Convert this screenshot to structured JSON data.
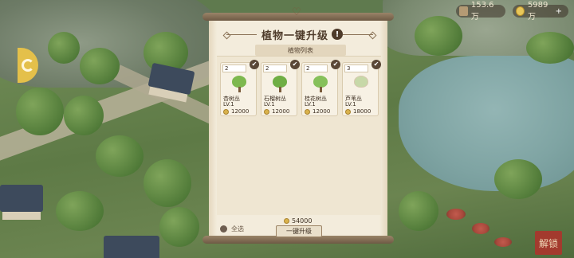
{
  "resources": {
    "gem_amount": "153.6万",
    "coin_amount": "5989万",
    "coin_plus": "+"
  },
  "dialog": {
    "title": "植物一键升级",
    "info_glyph": "!",
    "list_tab": "植物列表",
    "plants": [
      {
        "qty": "2",
        "name": "杏树丛",
        "level": "LV.1",
        "cost": "12000",
        "color": "#7db84e"
      },
      {
        "qty": "2",
        "name": "石榴树丛",
        "level": "LV.1",
        "cost": "12000",
        "color": "#6fae44"
      },
      {
        "qty": "2",
        "name": "桂花树丛",
        "level": "LV.1",
        "cost": "12000",
        "color": "#86c05a"
      },
      {
        "qty": "3",
        "name": "芦苇丛",
        "level": "LV.1",
        "cost": "18000",
        "color": "#c7d8a8"
      }
    ],
    "total_cost": "54000",
    "select_all_label": "全选",
    "upgrade_button": "一键升级"
  },
  "seal_text": "解锁"
}
